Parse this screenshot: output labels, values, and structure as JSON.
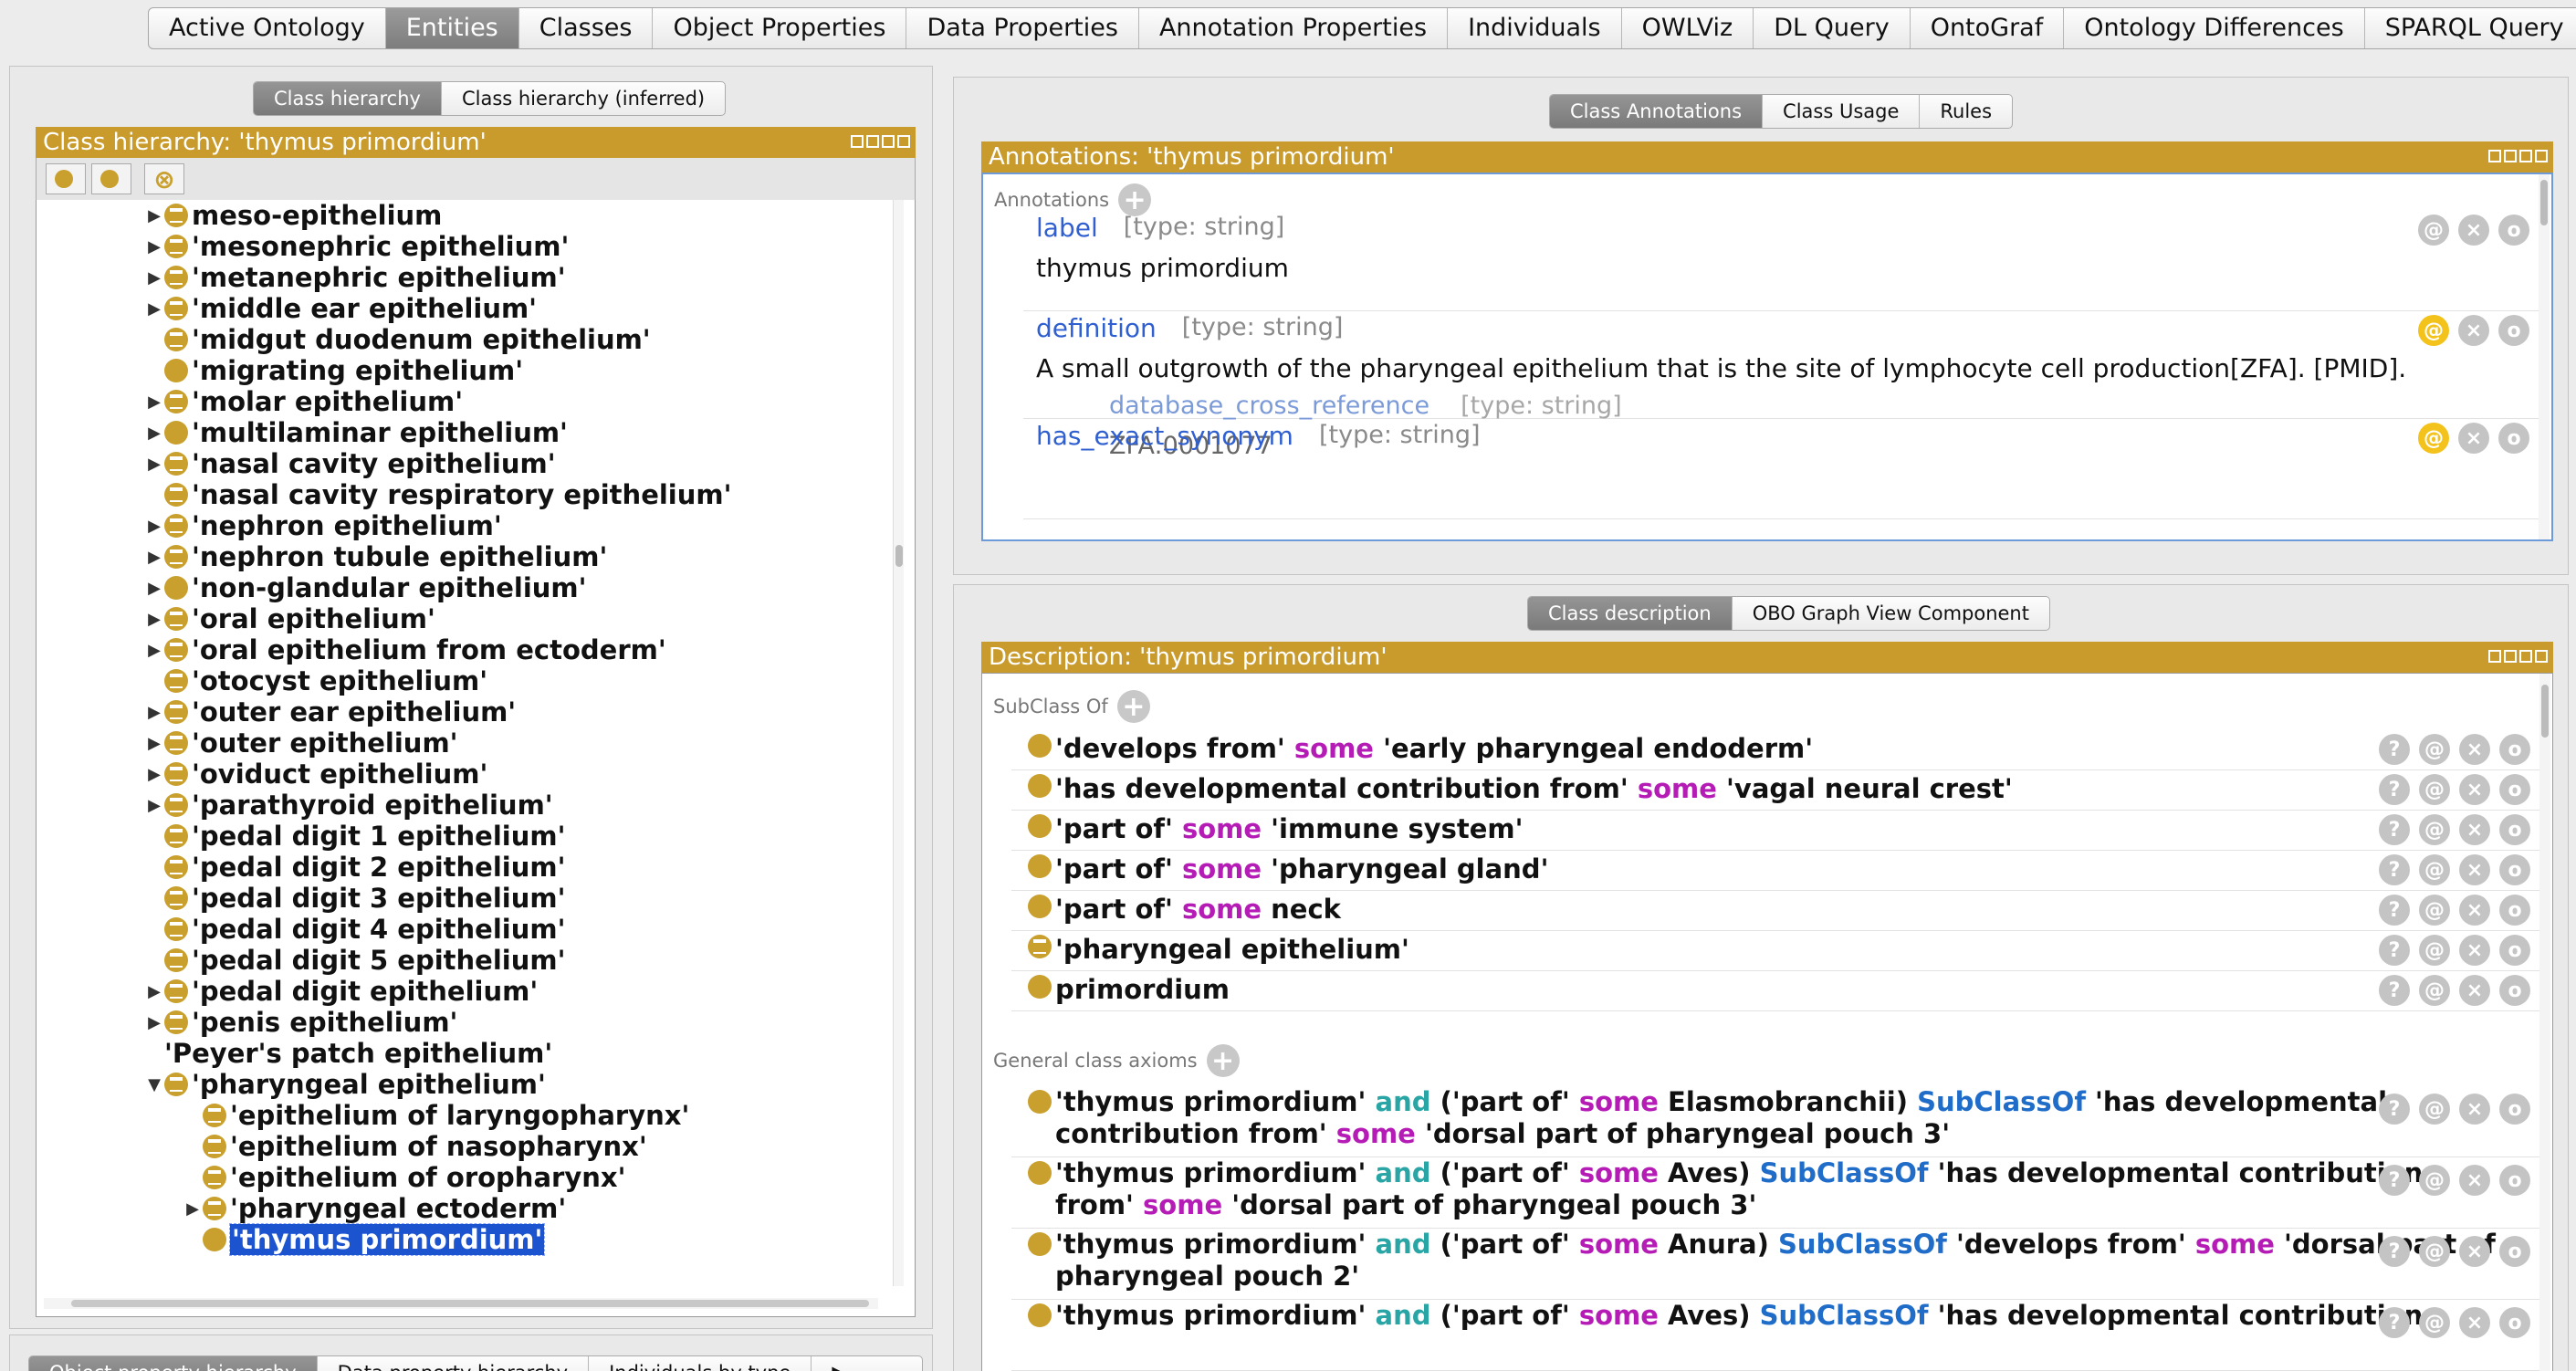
{
  "top_tabs": [
    {
      "label": "Active Ontology",
      "selected": false
    },
    {
      "label": "Entities",
      "selected": true
    },
    {
      "label": "Classes",
      "selected": false
    },
    {
      "label": "Object Properties",
      "selected": false
    },
    {
      "label": "Data Properties",
      "selected": false
    },
    {
      "label": "Annotation Properties",
      "selected": false
    },
    {
      "label": "Individuals",
      "selected": false
    },
    {
      "label": "OWLViz",
      "selected": false
    },
    {
      "label": "DL Query",
      "selected": false
    },
    {
      "label": "OntoGraf",
      "selected": false
    },
    {
      "label": "Ontology Differences",
      "selected": false
    },
    {
      "label": "SPARQL Query",
      "selected": false
    }
  ],
  "left": {
    "tabs": [
      {
        "label": "Class hierarchy",
        "selected": true
      },
      {
        "label": "Class hierarchy (inferred)",
        "selected": false
      }
    ],
    "title": "Class hierarchy: 'thymus primordium'",
    "tree": [
      {
        "label": "meso-epithelium",
        "arrow": "right",
        "icon": "defined",
        "indent": 0
      },
      {
        "label": "'mesonephric epithelium'",
        "arrow": "right",
        "icon": "defined",
        "indent": 0
      },
      {
        "label": "'metanephric epithelium'",
        "arrow": "right",
        "icon": "defined",
        "indent": 0
      },
      {
        "label": "'middle ear epithelium'",
        "arrow": "right",
        "icon": "defined",
        "indent": 0
      },
      {
        "label": "'midgut duodenum epithelium'",
        "arrow": "none",
        "icon": "defined",
        "indent": 0
      },
      {
        "label": "'migrating epithelium'",
        "arrow": "none",
        "icon": "primitive",
        "indent": 0
      },
      {
        "label": "'molar epithelium'",
        "arrow": "right",
        "icon": "defined",
        "indent": 0
      },
      {
        "label": "'multilaminar epithelium'",
        "arrow": "right",
        "icon": "primitive",
        "indent": 0
      },
      {
        "label": "'nasal cavity epithelium'",
        "arrow": "right",
        "icon": "defined",
        "indent": 0
      },
      {
        "label": "'nasal cavity respiratory epithelium'",
        "arrow": "none",
        "icon": "defined",
        "indent": 0
      },
      {
        "label": "'nephron epithelium'",
        "arrow": "right",
        "icon": "defined",
        "indent": 0
      },
      {
        "label": "'nephron tubule epithelium'",
        "arrow": "right",
        "icon": "defined",
        "indent": 0
      },
      {
        "label": "'non-glandular epithelium'",
        "arrow": "right",
        "icon": "primitive",
        "indent": 0
      },
      {
        "label": "'oral epithelium'",
        "arrow": "right",
        "icon": "defined",
        "indent": 0
      },
      {
        "label": "'oral epithelium from ectoderm'",
        "arrow": "right",
        "icon": "defined",
        "indent": 0
      },
      {
        "label": "'otocyst epithelium'",
        "arrow": "none",
        "icon": "defined",
        "indent": 0
      },
      {
        "label": "'outer ear epithelium'",
        "arrow": "right",
        "icon": "defined",
        "indent": 0
      },
      {
        "label": "'outer epithelium'",
        "arrow": "right",
        "icon": "defined",
        "indent": 0
      },
      {
        "label": "'oviduct epithelium'",
        "arrow": "right",
        "icon": "defined",
        "indent": 0
      },
      {
        "label": "'parathyroid epithelium'",
        "arrow": "right",
        "icon": "defined",
        "indent": 0
      },
      {
        "label": "'pedal digit 1 epithelium'",
        "arrow": "none",
        "icon": "defined",
        "indent": 0
      },
      {
        "label": "'pedal digit 2 epithelium'",
        "arrow": "none",
        "icon": "defined",
        "indent": 0
      },
      {
        "label": "'pedal digit 3 epithelium'",
        "arrow": "none",
        "icon": "defined",
        "indent": 0
      },
      {
        "label": "'pedal digit 4 epithelium'",
        "arrow": "none",
        "icon": "defined",
        "indent": 0
      },
      {
        "label": "'pedal digit 5 epithelium'",
        "arrow": "none",
        "icon": "defined",
        "indent": 0
      },
      {
        "label": "'pedal digit epithelium'",
        "arrow": "right",
        "icon": "defined",
        "indent": 0
      },
      {
        "label": "'penis epithelium'",
        "arrow": "right",
        "icon": "defined",
        "indent": 0
      },
      {
        "label": "'Peyer's patch epithelium'",
        "arrow": "none",
        "icon": "none",
        "indent": 0
      },
      {
        "label": "'pharyngeal epithelium'",
        "arrow": "down",
        "icon": "defined",
        "indent": 0
      },
      {
        "label": "'epithelium of laryngopharynx'",
        "arrow": "none",
        "icon": "defined",
        "indent": 1
      },
      {
        "label": "'epithelium of nasopharynx'",
        "arrow": "none",
        "icon": "defined",
        "indent": 1
      },
      {
        "label": "'epithelium of oropharynx'",
        "arrow": "none",
        "icon": "defined",
        "indent": 1
      },
      {
        "label": "'pharyngeal ectoderm'",
        "arrow": "right",
        "icon": "defined",
        "indent": 1
      },
      {
        "label": "'thymus primordium'",
        "arrow": "none",
        "icon": "primitive",
        "indent": 1,
        "selected": true
      }
    ],
    "bottom_tabs": [
      {
        "label": "Object property hierarchy",
        "selected": true
      },
      {
        "label": "Data property hierarchy",
        "selected": false
      },
      {
        "label": "Individuals by type",
        "selected": false
      }
    ]
  },
  "annotations": {
    "tabs": [
      {
        "label": "Class Annotations",
        "selected": true
      },
      {
        "label": "Class Usage",
        "selected": false
      },
      {
        "label": "Rules",
        "selected": false
      }
    ],
    "title": "Annotations: 'thymus primordium'",
    "section": "Annotations",
    "items": [
      {
        "key": "label",
        "type": "[type: string]",
        "value": "thymus primordium",
        "at_active": false
      },
      {
        "key": "definition",
        "type": "[type: string]",
        "value": "A small outgrowth of the pharyngeal epithelium that is the site of lymphocyte cell production[ZFA]. [PMID].",
        "at_active": true,
        "sub_key": "database_cross_reference",
        "sub_type": "[type: string]",
        "sub_value": "ZFA:0001077"
      },
      {
        "key": "has_exact_synonym",
        "type": "[type: string]",
        "value": "",
        "at_active": true
      }
    ]
  },
  "description": {
    "tabs": [
      {
        "label": "Class description",
        "selected": true
      },
      {
        "label": "OBO Graph View Component",
        "selected": false
      }
    ],
    "title": "Description: 'thymus primordium'",
    "subclass_section": "SubClass Of",
    "subclass_of": [
      {
        "icon": "primitive",
        "parts": [
          [
            "'develops from' ",
            ""
          ],
          [
            "some",
            "some"
          ],
          [
            " 'early pharyngeal endoderm'",
            ""
          ]
        ]
      },
      {
        "icon": "primitive",
        "parts": [
          [
            "'has developmental contribution from' ",
            ""
          ],
          [
            "some",
            "some"
          ],
          [
            " 'vagal neural crest'",
            ""
          ]
        ]
      },
      {
        "icon": "primitive",
        "parts": [
          [
            "'part of' ",
            ""
          ],
          [
            "some",
            "some"
          ],
          [
            " 'immune system'",
            ""
          ]
        ]
      },
      {
        "icon": "primitive",
        "parts": [
          [
            "'part of' ",
            ""
          ],
          [
            "some",
            "some"
          ],
          [
            " 'pharyngeal gland'",
            ""
          ]
        ]
      },
      {
        "icon": "primitive",
        "parts": [
          [
            "'part of' ",
            ""
          ],
          [
            "some",
            "some"
          ],
          [
            " neck",
            ""
          ]
        ]
      },
      {
        "icon": "defined",
        "parts": [
          [
            "'pharyngeal epithelium'",
            ""
          ]
        ]
      },
      {
        "icon": "primitive",
        "parts": [
          [
            "primordium",
            ""
          ]
        ]
      }
    ],
    "gca_section": "General class axioms",
    "general_class_axioms": [
      {
        "lines": [
          [
            [
              "'thymus primordium' ",
              ""
            ],
            [
              "and",
              "and"
            ],
            [
              " ('part of' ",
              ""
            ],
            [
              "some",
              "some"
            ],
            [
              " Elasmobranchii) ",
              ""
            ],
            [
              "SubClassOf",
              "sub"
            ],
            [
              " 'has developmental",
              ""
            ]
          ],
          [
            [
              "contribution from' ",
              ""
            ],
            [
              "some",
              "some"
            ],
            [
              " 'dorsal part of pharyngeal pouch 3'",
              ""
            ]
          ]
        ]
      },
      {
        "lines": [
          [
            [
              "'thymus primordium' ",
              ""
            ],
            [
              "and",
              "and"
            ],
            [
              " ('part of' ",
              ""
            ],
            [
              "some",
              "some"
            ],
            [
              " Aves) ",
              ""
            ],
            [
              "SubClassOf",
              "sub"
            ],
            [
              " 'has developmental contribution",
              ""
            ]
          ],
          [
            [
              "from' ",
              ""
            ],
            [
              "some",
              "some"
            ],
            [
              " 'dorsal part of pharyngeal pouch 3'",
              ""
            ]
          ]
        ]
      },
      {
        "lines": [
          [
            [
              "'thymus primordium' ",
              ""
            ],
            [
              "and",
              "and"
            ],
            [
              " ('part of' ",
              ""
            ],
            [
              "some",
              "some"
            ],
            [
              " Anura) ",
              ""
            ],
            [
              "SubClassOf",
              "sub"
            ],
            [
              " 'develops from' ",
              ""
            ],
            [
              "some",
              "some"
            ],
            [
              " 'dorsal part of",
              ""
            ]
          ],
          [
            [
              "pharyngeal pouch 2'",
              ""
            ]
          ]
        ]
      },
      {
        "lines": [
          [
            [
              "'thymus primordium' ",
              ""
            ],
            [
              "and",
              "and"
            ],
            [
              " ('part of' ",
              ""
            ],
            [
              "some",
              "some"
            ],
            [
              " Aves) ",
              ""
            ],
            [
              "SubClassOf",
              "sub"
            ],
            [
              " 'has developmental contribution",
              ""
            ]
          ]
        ]
      }
    ]
  },
  "icons": {
    "at": "@",
    "close": "×",
    "info": "?",
    "options": "o",
    "plus": "+"
  },
  "colors": {
    "titlebar": "#c99b2d",
    "some": "#b51bb5",
    "and": "#2aa5a5",
    "subclassof": "#1f6cc9",
    "selection": "#1c54d0"
  }
}
